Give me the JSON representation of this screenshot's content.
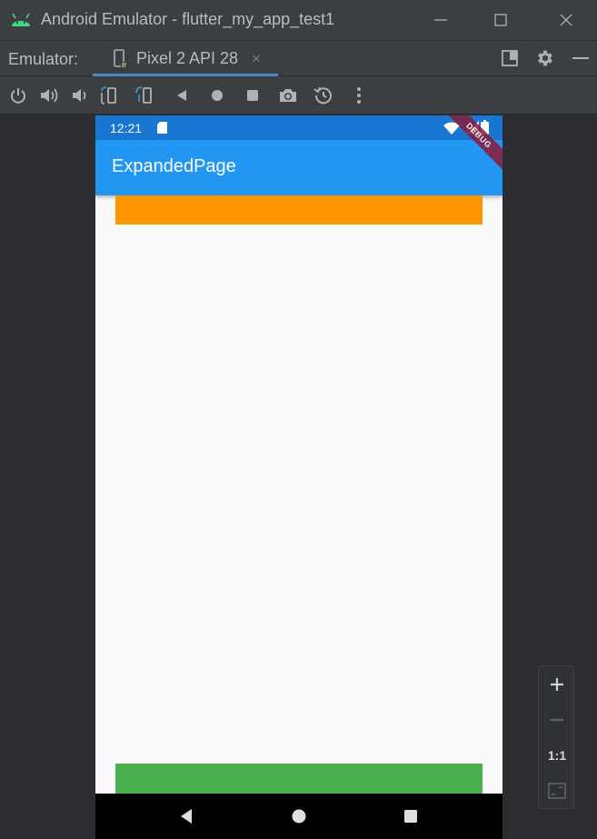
{
  "window": {
    "title": "Android Emulator - flutter_my_app_test1"
  },
  "tabbar": {
    "label": "Emulator:",
    "tab_label": "Pixel 2 API 28",
    "tab_close": "×"
  },
  "device": {
    "status_time": "12:21",
    "appbar_title": "ExpandedPage",
    "debug_banner": "DEBUG",
    "colors": {
      "status_bar": "#1976d2",
      "app_bar": "#2196f3",
      "orange_box": "#ff9800",
      "green_box": "#4caf50"
    }
  },
  "zoom": {
    "ratio_label": "1:1"
  },
  "icons": {
    "title": [
      "android-icon",
      "minimize-icon",
      "maximize-icon",
      "close-icon"
    ],
    "toolbar": [
      "power-icon",
      "volume-up-icon",
      "volume-down-icon",
      "rotate-left-icon",
      "rotate-right-icon",
      "back-icon",
      "home-icon",
      "overview-icon",
      "camera-icon",
      "snapshot-icon",
      "more-icon"
    ],
    "nav": [
      "nav-back-icon",
      "nav-home-icon",
      "nav-recents-icon"
    ]
  }
}
